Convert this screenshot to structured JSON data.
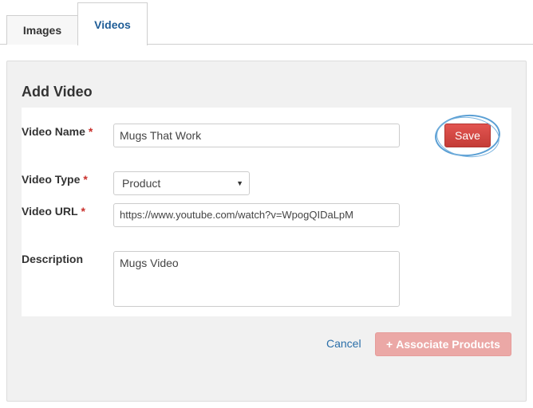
{
  "tabs": [
    {
      "label": "Images",
      "active": false
    },
    {
      "label": "Videos",
      "active": true
    }
  ],
  "panel": {
    "title": "Add Video"
  },
  "form": {
    "required_marker": "*",
    "video_name": {
      "label": "Video Name",
      "value": "Mugs That Work"
    },
    "video_type": {
      "label": "Video Type",
      "selected": "Product"
    },
    "video_url": {
      "label": "Video URL",
      "value": "https://www.youtube.com/watch?v=WpogQIDaLpM"
    },
    "description": {
      "label": "Description",
      "value": "Mugs Video"
    }
  },
  "actions": {
    "save_label": "Save",
    "cancel_label": "Cancel",
    "associate_label": "Associate Products"
  },
  "icons": {
    "plus": "+",
    "dropdown_arrow": "▼"
  },
  "colors": {
    "save_button": "#d9534f",
    "associate_button_disabled": "#eba8a6",
    "link": "#2a6ea8",
    "active_tab_text": "#1f5d97",
    "annotation_circle": "#5a9fd4"
  }
}
